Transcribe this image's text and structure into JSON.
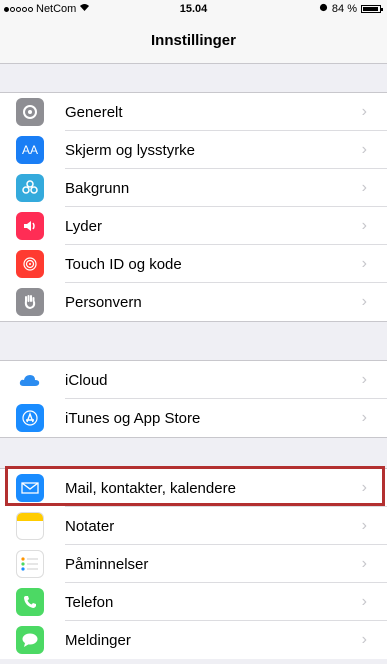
{
  "status": {
    "carrier": "NetCom",
    "time": "15.04",
    "battery": "84 %"
  },
  "nav": {
    "title": "Innstillinger"
  },
  "group1": [
    {
      "label": "Generelt",
      "icon": "gear-icon",
      "color": "#8e8e93"
    },
    {
      "label": "Skjerm og lysstyrke",
      "icon": "display-icon",
      "color": "#1a7ef5"
    },
    {
      "label": "Bakgrunn",
      "icon": "wallpaper-icon",
      "color": "#34aadc"
    },
    {
      "label": "Lyder",
      "icon": "speaker-icon",
      "color": "#ff2d55"
    },
    {
      "label": "Touch ID og kode",
      "icon": "fingerprint-icon",
      "color": "#ff3b30"
    },
    {
      "label": "Personvern",
      "icon": "hand-icon",
      "color": "#8e8e93"
    }
  ],
  "group2": [
    {
      "label": "iCloud",
      "icon": "cloud-icon",
      "color": "#ffffff"
    },
    {
      "label": "iTunes og App Store",
      "icon": "app-store-icon",
      "color": "#1a8cff"
    }
  ],
  "group3": [
    {
      "label": "Mail, kontakter, kalendere",
      "icon": "mail-icon",
      "color": "#1a8cff"
    },
    {
      "label": "Notater",
      "icon": "notes-icon",
      "color": "#ffcc00"
    },
    {
      "label": "Påminnelser",
      "icon": "reminders-icon",
      "color": "#ffffff"
    },
    {
      "label": "Telefon",
      "icon": "phone-icon",
      "color": "#4cd964"
    },
    {
      "label": "Meldinger",
      "icon": "messages-icon",
      "color": "#4cd964"
    }
  ]
}
